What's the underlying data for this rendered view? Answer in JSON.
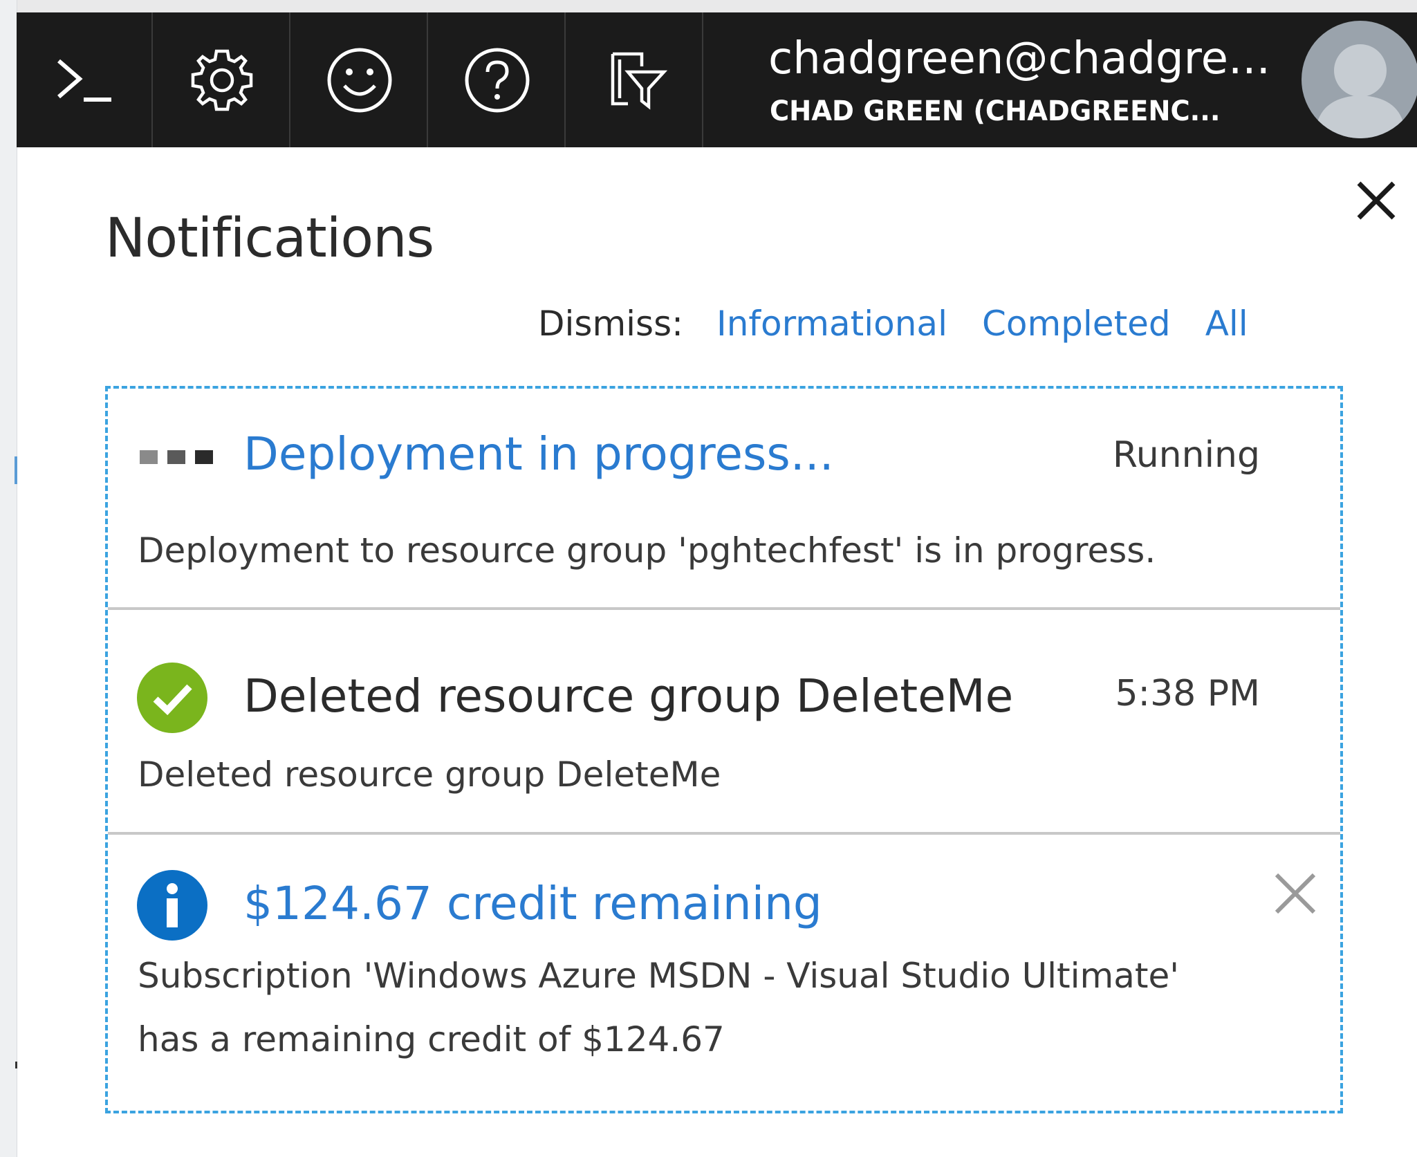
{
  "topbar": {
    "buttons": [
      {
        "name": "cloud-shell",
        "icon": "terminal-prompt-icon"
      },
      {
        "name": "settings",
        "icon": "gear-icon"
      },
      {
        "name": "feedback",
        "icon": "smiley-icon"
      },
      {
        "name": "help",
        "icon": "question-circle-icon"
      },
      {
        "name": "directory-filter",
        "icon": "directory-filter-icon"
      }
    ],
    "account": {
      "email": "chadgreen@chadgre...",
      "directory": "CHAD GREEN (CHADGREENC..."
    },
    "avatar_icon": "person-silhouette-icon"
  },
  "notifications": {
    "title": "Notifications",
    "dismiss": {
      "label": "Dismiss:",
      "informational": "Informational",
      "completed": "Completed",
      "all": "All"
    },
    "items": [
      {
        "icon": "progress-dots-icon",
        "title": "Deployment in progress...",
        "status": "Running",
        "body": "Deployment to resource group 'pghtechfest' is in progress."
      },
      {
        "icon": "success-check-icon",
        "title": "Deleted resource group DeleteMe",
        "status": "5:38 PM",
        "body": "Deleted resource group DeleteMe"
      },
      {
        "icon": "info-icon",
        "title": "$124.67 credit remaining",
        "body_line1": "Subscription 'Windows Azure MSDN - Visual Studio Ultimate'",
        "body_line2": "has a remaining credit of $124.67"
      }
    ]
  },
  "colors": {
    "topbar_bg": "#1b1b1b",
    "link": "#2a7bd0",
    "success": "#7ab51d",
    "info": "#0b6fc4",
    "focus_border": "#3ba3e0"
  }
}
